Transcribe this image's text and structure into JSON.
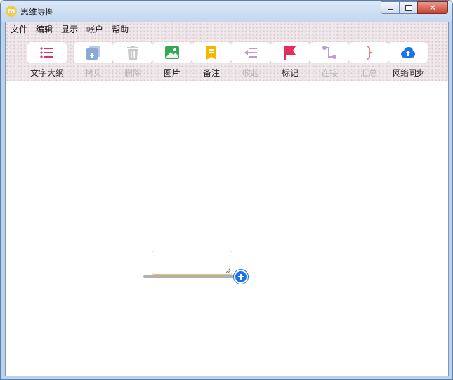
{
  "window": {
    "title": "思维导图",
    "app_icon_glyph": "m",
    "controls": {
      "minimize": "minimize",
      "maximize": "maximize",
      "close": "✕"
    }
  },
  "menu": [
    "文件",
    "编辑",
    "显示",
    "帐户",
    "帮助"
  ],
  "toolbar": [
    {
      "label": "文字大纲",
      "icon": "outline-list-icon",
      "enabled": true,
      "color": "#e1306c"
    },
    {
      "label": "拷贝",
      "icon": "copy-icon",
      "enabled": false,
      "color": "#8aa9d6"
    },
    {
      "label": "删除",
      "icon": "trash-icon",
      "enabled": false,
      "color": "#c9c9c9"
    },
    {
      "label": "图片",
      "icon": "image-icon",
      "enabled": true,
      "color": "#34a853"
    },
    {
      "label": "备注",
      "icon": "note-icon",
      "enabled": true,
      "color": "#f5b800"
    },
    {
      "label": "收起",
      "icon": "collapse-icon",
      "enabled": false,
      "color": "#c39bd3"
    },
    {
      "label": "标记",
      "icon": "flag-icon",
      "enabled": true,
      "color": "#e02f5c"
    },
    {
      "label": "连接",
      "icon": "connect-icon",
      "enabled": false,
      "color": "#c39bd3"
    },
    {
      "label": "汇总",
      "icon": "summary-brace-icon",
      "enabled": false,
      "color": "#f08080"
    },
    {
      "label": "网络同步",
      "icon": "cloud-upload-icon",
      "enabled": true,
      "color": "#1a73e8"
    }
  ],
  "canvas": {
    "node_text": "",
    "add_button": "add-child-icon"
  }
}
